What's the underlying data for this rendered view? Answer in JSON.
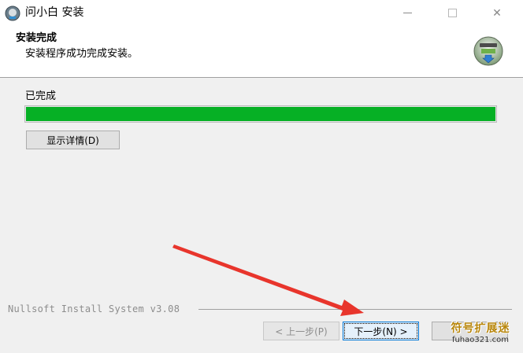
{
  "window": {
    "title": "问小白 安装",
    "minimize_icon": "minimize-icon",
    "maximize_icon": "maximize-icon",
    "close_glyph": "✕"
  },
  "header": {
    "title": "安装完成",
    "subtitle": "安装程序成功完成安装。",
    "icon": "nsis-installer-icon"
  },
  "content": {
    "status": "已完成",
    "progress_percent": 100,
    "progress_color": "#06b025",
    "details_button": "显示详情(D)"
  },
  "footer": {
    "branding": "Nullsoft Install System v3.08",
    "back_button": "< 上一步(P)",
    "next_button": "下一步(N) >",
    "cancel_button": ""
  },
  "watermark": {
    "top": "符号扩展迷",
    "bottom": "fuhao321.com"
  },
  "annotation": {
    "arrow_color": "#e8352c"
  }
}
